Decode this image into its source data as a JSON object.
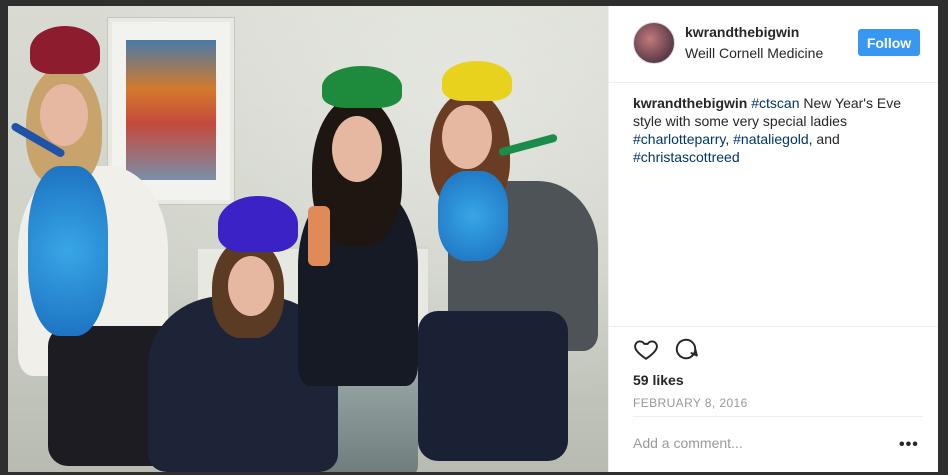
{
  "post": {
    "photo_alt_icon": "photo-scene",
    "header": {
      "username": "kwrandthebigwin",
      "location": "Weill Cornell Medicine",
      "follow_label": "Follow"
    },
    "caption": {
      "username": "kwrandthebigwin",
      "hashtag_ctscan": "#ctscan",
      "text_1": " New Year's Eve style with some very special ladies ",
      "hashtag_1": "#charlotteparry",
      "sep_1": ", ",
      "hashtag_2": "#nataliegold",
      "sep_2": ", and ",
      "hashtag_3": "#christascottreed"
    },
    "actions": {
      "like_icon": "heart-icon",
      "comment_icon": "comment-icon"
    },
    "likes_text": "59 likes",
    "date_text": "FEBRUARY 8, 2016",
    "comment_placeholder": "Add a comment...",
    "more_label": "•••"
  },
  "colors": {
    "accent": "#3897f0",
    "hashtag": "#003569",
    "muted": "#999999",
    "text": "#262626"
  }
}
